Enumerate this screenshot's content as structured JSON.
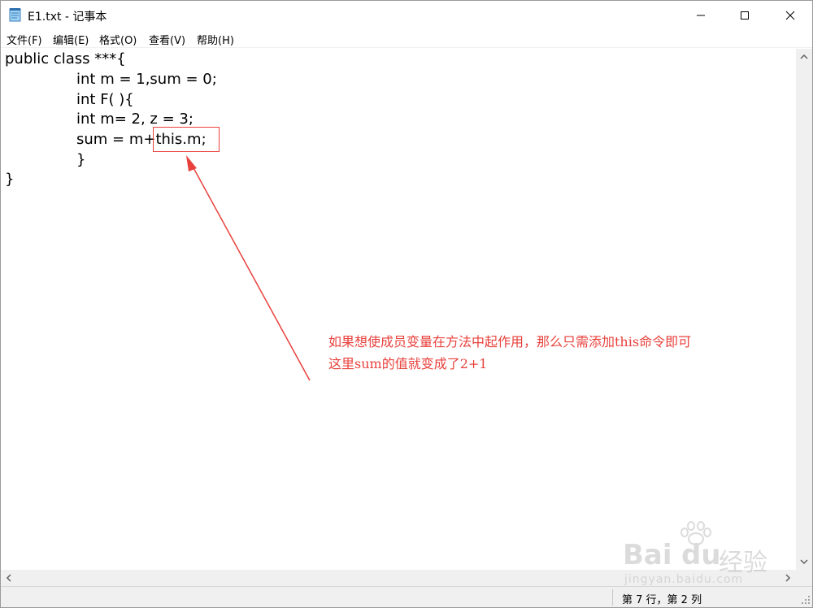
{
  "window": {
    "title": "E1.txt - 记事本"
  },
  "menu": {
    "items": [
      "文件(F)",
      "编辑(E)",
      "格式(O)",
      "查看(V)",
      "帮助(H)"
    ]
  },
  "editor": {
    "lines": [
      "public class ***{",
      "int m = 1,sum = 0;",
      "int F( ){",
      "int m= 2, z = 3;",
      "sum = m+this.m;",
      "}",
      "}"
    ]
  },
  "annotation": {
    "line1": "如果想使成员变量在方法中起作用，那么只需添加this命令即可",
    "line2": "这里sum的值就变成了2+1",
    "color": "#e8413c"
  },
  "status": {
    "position": "第 7 行，第 2 列"
  },
  "watermark": {
    "logo": "Bai",
    "logo_suffix": "du",
    "brand_cn": "经验",
    "url": "jingyan.baidu.com"
  }
}
